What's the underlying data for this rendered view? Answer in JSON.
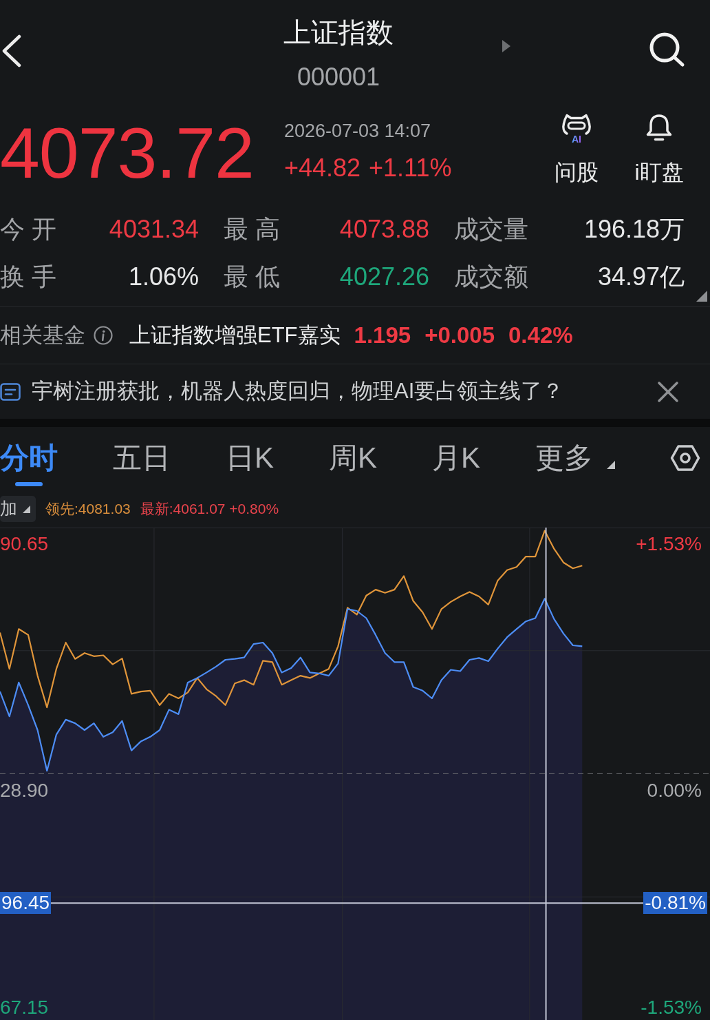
{
  "header": {
    "title": "上证指数",
    "code": "000001"
  },
  "quote": {
    "price": "4073.72",
    "time": "2026-07-03 14:07",
    "change": "+44.82",
    "change_pct": "+1.11%"
  },
  "actions": [
    {
      "kind": "ai",
      "label": "问股",
      "badge": "AI"
    },
    {
      "kind": "alert",
      "label": "i盯盘"
    }
  ],
  "stats": [
    {
      "label": "今 开",
      "value": "4031.34",
      "color": "#ee3a44"
    },
    {
      "label": "最 高",
      "value": "4073.88",
      "color": "#ee3a44"
    },
    {
      "label": "成交量",
      "value": "196.18万",
      "color": "#e7e8e9"
    },
    {
      "label": "换 手",
      "value": "1.06%",
      "color": "#e7e8e9"
    },
    {
      "label": "最 低",
      "value": "4027.26",
      "color": "#1ea77b"
    },
    {
      "label": "成交额",
      "value": "34.97亿",
      "color": "#e7e8e9"
    }
  ],
  "related_fund": {
    "label": "相关基金",
    "name": "上证指数增强ETF嘉实",
    "price": "1.195",
    "change": "+0.005",
    "change_pct": "0.42%"
  },
  "news": {
    "text": "宇树注册获批，机器人热度回归，物理AI要占领主线了？"
  },
  "chart_tabs": [
    {
      "label": "分时",
      "selected": true,
      "kind": "period"
    },
    {
      "label": "五日",
      "selected": false,
      "kind": "period"
    },
    {
      "label": "日K",
      "selected": false,
      "kind": "period"
    },
    {
      "label": "周K",
      "selected": false,
      "kind": "period"
    },
    {
      "label": "月K",
      "selected": false,
      "kind": "period"
    },
    {
      "label": "更多",
      "selected": false,
      "kind": "menu"
    }
  ],
  "overlay": {
    "label": "加"
  },
  "legend": [
    {
      "text": "领先:4081.03",
      "color": "#d98e3c"
    },
    {
      "text": "最新:4061.07 +0.80%",
      "color": "#e8434c"
    }
  ],
  "chart": {
    "price_labels": [
      {
        "text": "90.65",
        "color": "#ee3a44"
      },
      {
        "text": "28.90",
        "color": "#a9abae"
      },
      {
        "text": "67.15",
        "color": "#1ea77b"
      }
    ],
    "percent_labels": [
      {
        "text": "+1.53%",
        "color": "#ee3a44"
      },
      {
        "text": "0.00%",
        "color": "#a9abae"
      },
      {
        "text": "-1.53%",
        "color": "#1ea77b"
      }
    ],
    "crosshair": {
      "price_label": "96.45",
      "percent_label": "-0.81%"
    }
  }
}
